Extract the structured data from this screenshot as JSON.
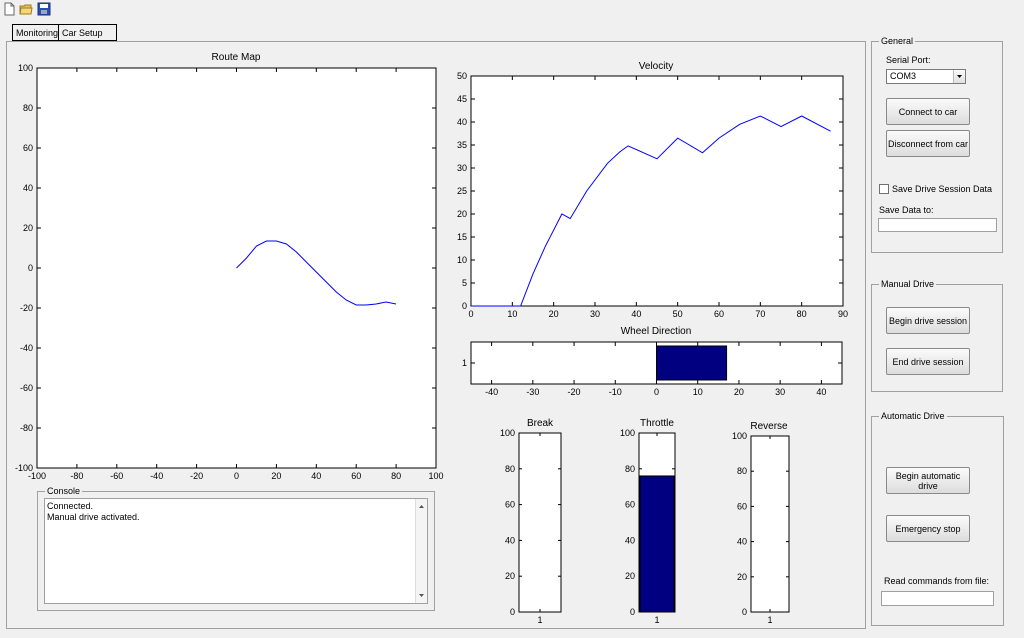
{
  "toolbar": {
    "icons": [
      "new-file-icon",
      "open-folder-icon",
      "save-icon"
    ]
  },
  "tabs": [
    {
      "label": "Monitoring"
    },
    {
      "label": "Car Setup"
    }
  ],
  "route_map": {
    "title": "Route Map"
  },
  "velocity": {
    "title": "Velocity"
  },
  "wheel": {
    "title": "Wheel Direction"
  },
  "break_gauge": {
    "title": "Break"
  },
  "throttle_gauge": {
    "title": "Throttle"
  },
  "reverse_gauge": {
    "title": "Reverse"
  },
  "console": {
    "title": "Console",
    "lines": [
      "Connected.",
      "Manual drive activated."
    ]
  },
  "general": {
    "title": "General",
    "serial_port_label": "Serial Port:",
    "serial_port_value": "COM3",
    "connect_label": "Connect to car",
    "disconnect_label": "Disconnect from car",
    "save_session_label": "Save Drive Session Data",
    "save_data_label": "Save Data to:",
    "save_data_value": ""
  },
  "manual": {
    "title": "Manual Drive",
    "begin_label": "Begin drive session",
    "end_label": "End drive session"
  },
  "automatic": {
    "title": "Automatic Drive",
    "begin_label": "Begin automatic drive",
    "emergency_label": "Emergency stop",
    "read_commands_label": "Read commands from file:",
    "read_commands_value": ""
  },
  "colors": {
    "line": "#0000ff",
    "bar": "#000080"
  },
  "chart_data": [
    {
      "type": "line",
      "name": "route_map",
      "title": "Route Map",
      "xlim": [
        -100,
        100
      ],
      "ylim": [
        -100,
        100
      ],
      "xticks": [
        -100,
        -80,
        -60,
        -40,
        -20,
        0,
        20,
        40,
        60,
        80,
        100
      ],
      "yticks": [
        -100,
        -80,
        -60,
        -40,
        -20,
        0,
        20,
        40,
        60,
        80,
        100
      ],
      "series": [
        {
          "x": [
            0,
            5,
            10,
            15,
            20,
            25,
            30,
            35,
            40,
            45,
            50,
            55,
            60,
            65,
            70,
            75,
            80
          ],
          "y": [
            0,
            5,
            11,
            13.5,
            13.5,
            12,
            8,
            3,
            -2,
            -7,
            -12,
            -16,
            -18.5,
            -18.5,
            -18,
            -17,
            -18
          ]
        }
      ]
    },
    {
      "type": "line",
      "name": "velocity",
      "title": "Velocity",
      "xlim": [
        0,
        90
      ],
      "ylim": [
        0,
        50
      ],
      "xticks": [
        0,
        10,
        20,
        30,
        40,
        50,
        60,
        70,
        80,
        90
      ],
      "yticks": [
        0,
        5,
        10,
        15,
        20,
        25,
        30,
        35,
        40,
        45,
        50
      ],
      "series": [
        {
          "x": [
            0,
            11,
            12,
            15,
            18,
            22,
            24,
            28,
            33,
            36,
            38,
            45,
            50,
            56,
            60,
            65,
            70,
            75,
            80,
            87
          ],
          "y": [
            0,
            0,
            0,
            7,
            13,
            20,
            19,
            25,
            31,
            33.5,
            34.8,
            32,
            36.5,
            33.3,
            36.5,
            39.5,
            41.3,
            39,
            41.3,
            38
          ]
        }
      ]
    },
    {
      "type": "bar",
      "name": "wheel_direction",
      "title": "Wheel Direction",
      "orientation": "horizontal",
      "xlim": [
        -45,
        45
      ],
      "xticks": [
        -40,
        -30,
        -20,
        -10,
        0,
        10,
        20,
        30,
        40
      ],
      "categories": [
        "1"
      ],
      "values": [
        17
      ]
    },
    {
      "type": "bar",
      "name": "break",
      "title": "Break",
      "ylim": [
        0,
        100
      ],
      "yticks": [
        0,
        20,
        40,
        60,
        80,
        100
      ],
      "categories": [
        "1"
      ],
      "values": [
        0
      ]
    },
    {
      "type": "bar",
      "name": "throttle",
      "title": "Throttle",
      "ylim": [
        0,
        100
      ],
      "yticks": [
        0,
        20,
        40,
        60,
        80,
        100
      ],
      "categories": [
        "1"
      ],
      "values": [
        76
      ]
    },
    {
      "type": "bar",
      "name": "reverse",
      "title": "Reverse",
      "ylim": [
        0,
        100
      ],
      "yticks": [
        0,
        20,
        40,
        60,
        80,
        100
      ],
      "categories": [
        "1"
      ],
      "values": [
        0
      ]
    }
  ]
}
